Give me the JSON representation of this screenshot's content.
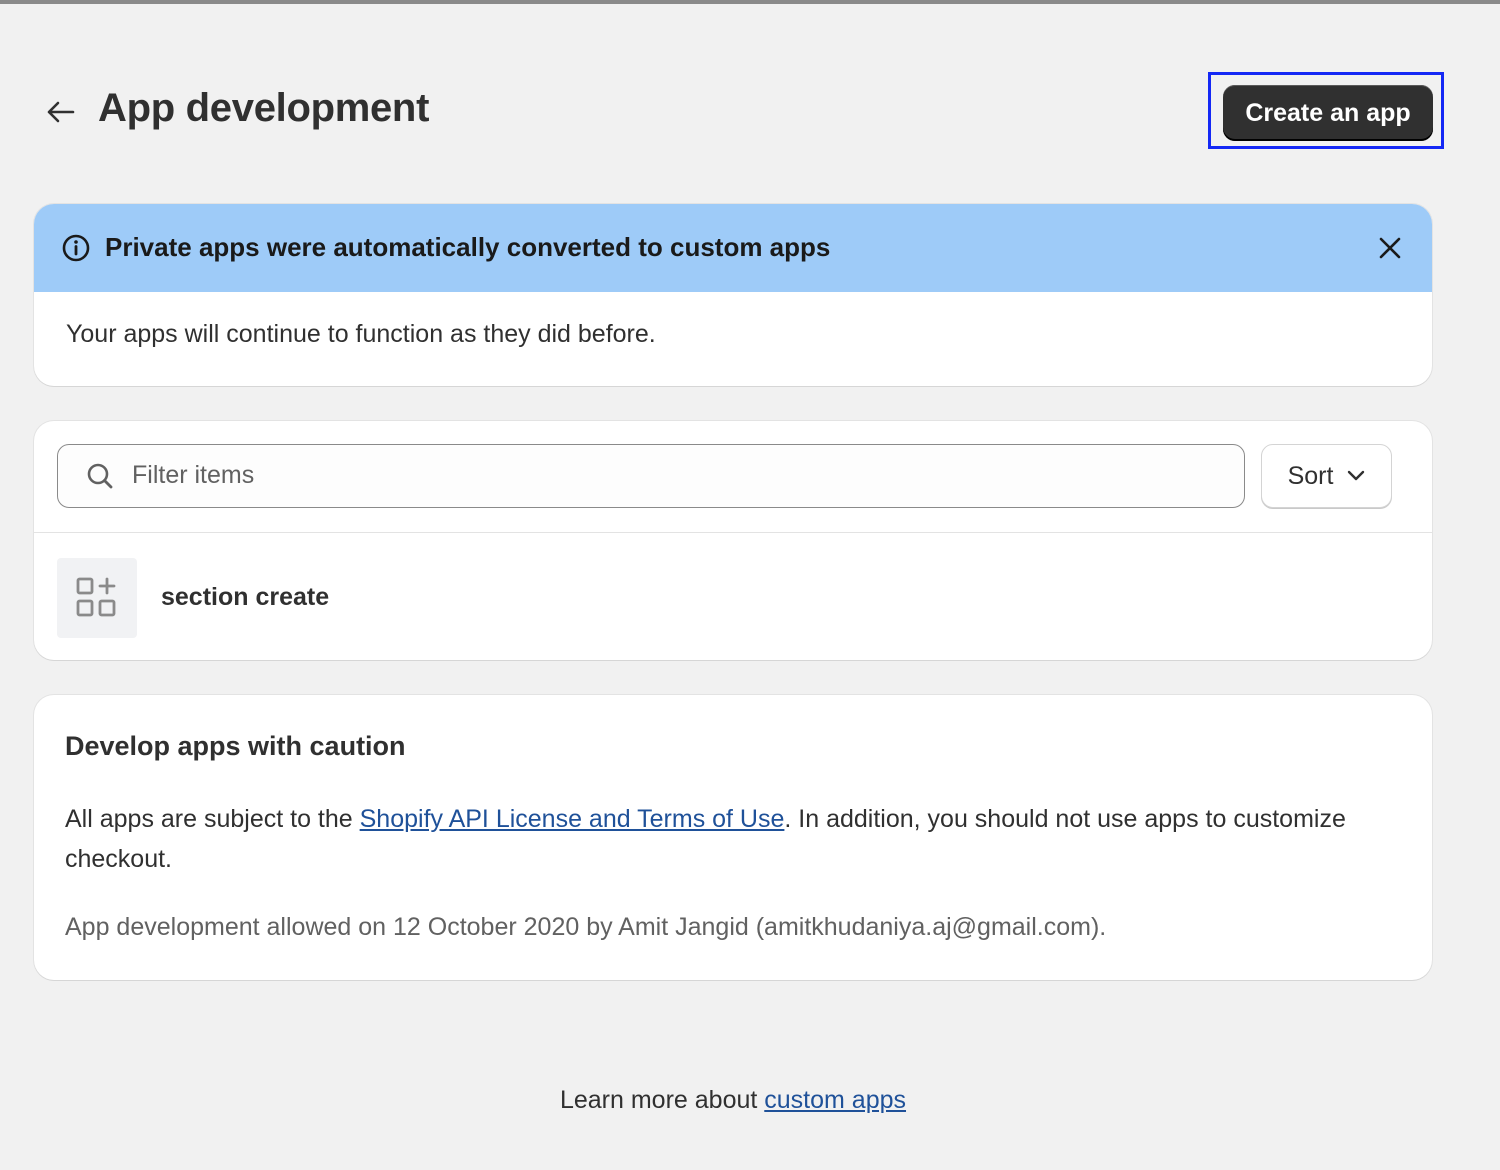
{
  "header": {
    "title": "App development",
    "create_button_label": "Create an app"
  },
  "banner": {
    "title": "Private apps were automatically converted to custom apps",
    "body": "Your apps will continue to function as they did before."
  },
  "apps_list": {
    "search_placeholder": "Filter items",
    "sort_label": "Sort",
    "items": [
      {
        "name": "section create"
      }
    ]
  },
  "caution": {
    "title": "Develop apps with caution",
    "text_before_link": "All apps are subject to the ",
    "link_label": "Shopify API License and Terms of Use",
    "text_after_link": ". In addition, you should not use apps to customize checkout.",
    "meta": "App development allowed on 12 October 2020 by Amit Jangid (amitkhudaniya.aj@gmail.com)."
  },
  "footer": {
    "text": "Learn more about ",
    "link_label": "custom apps"
  },
  "colors": {
    "banner_bg": "#9ecbf8",
    "primary_button": "#303030",
    "link": "#1f5199",
    "highlight_border": "#1428f5"
  },
  "icons": [
    "arrow-left-icon",
    "info-icon",
    "close-icon",
    "search-icon",
    "chevron-down-icon",
    "apps-grid-icon"
  ]
}
